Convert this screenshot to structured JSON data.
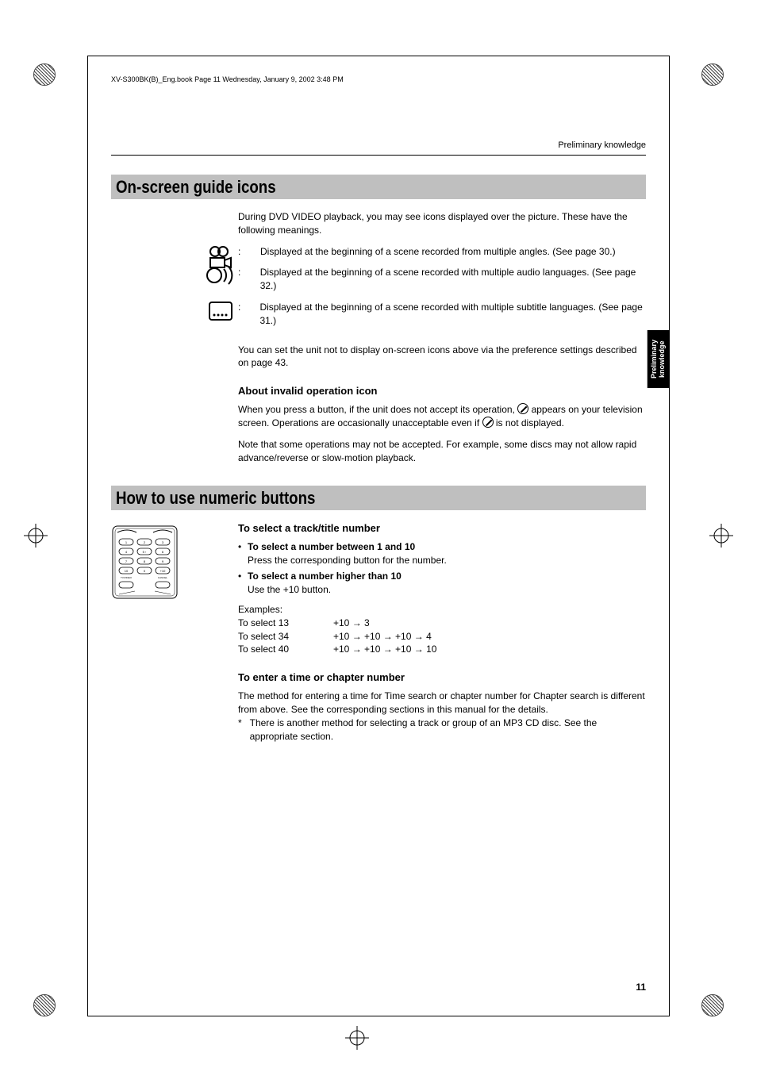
{
  "doc": {
    "book_header": "XV-S300BK(B)_Eng.book  Page 11  Wednesday, January 9, 2002  3:48 PM",
    "top_right": "Preliminary knowledge",
    "side_tab_line1": "Preliminary",
    "side_tab_line2": "knowledge",
    "page_number": "11"
  },
  "section1": {
    "title": "On-screen guide icons",
    "intro": "During DVD VIDEO playback, you may see icons displayed over the picture.  These have the following meanings.",
    "icons": [
      {
        "name": "angle-icon",
        "text": "Displayed at the beginning of a scene recorded from multiple angles. (See page 30.)"
      },
      {
        "name": "audio-icon",
        "text": "Displayed at the beginning of a scene recorded with multiple audio languages. (See page 32.)"
      },
      {
        "name": "subtitle-icon",
        "text": "Displayed at the beginning of a scene recorded with multiple subtitle languages.  (See page 31.)"
      }
    ],
    "after_icons": "You can set the unit not to display on-screen icons above via the preference settings described on page 43.",
    "invalid_heading": "About invalid operation icon",
    "invalid_p1a": "When you press a button, if the unit does not accept its operation, ",
    "invalid_p1b": " appears on your television screen. Operations are occasionally unacceptable even if ",
    "invalid_p1c": " is not displayed.",
    "invalid_p2": "Note that some operations may not be accepted. For example, some discs may not allow rapid advance/reverse or slow-motion playback."
  },
  "section2": {
    "title": "How to use numeric buttons",
    "sub1": "To select a track/title number",
    "bullet1_head": "To select a number between 1 and 10",
    "bullet1_body": "Press the corresponding button for the number.",
    "bullet2_head": "To select a number higher than 10",
    "bullet2_body": "Use the +10 button.",
    "examples_label": "Examples:",
    "examples": [
      {
        "label": "To select 13",
        "seq": "+10 → 3"
      },
      {
        "label": "To select 34",
        "seq": "+10 → +10 → +10 → 4"
      },
      {
        "label": "To select 40",
        "seq": "+10 → +10 → +10 → 10"
      }
    ],
    "sub2": "To enter a time or chapter number",
    "sub2_body": "The method for entering a time for Time search or chapter number for Chapter search is different from above. See the corresponding sections in this manual for the details.",
    "star_note": "There is another method for selecting a track or group of an MP3 CD disc. See the appropriate section."
  },
  "remote_keys": [
    "1",
    "2",
    "3",
    "4",
    "5 ‹",
    "6",
    "7",
    "8",
    "9",
    "10",
    "0",
    "+10",
    "TV/VIDEO",
    "CANCEL"
  ]
}
